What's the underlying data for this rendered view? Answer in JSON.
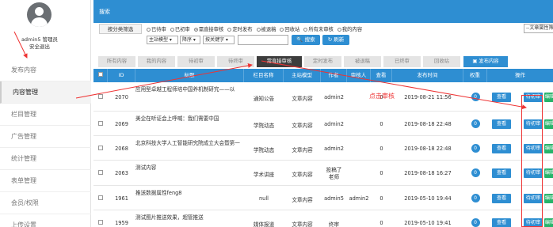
{
  "sidebar": {
    "user": "admin5 管理员",
    "logout": "安全退出",
    "items": [
      {
        "label": "发布内容"
      },
      {
        "label": "内容管理"
      },
      {
        "label": "栏目管理"
      },
      {
        "label": "广告管理"
      },
      {
        "label": "统计管理"
      },
      {
        "label": "表单管理"
      },
      {
        "label": "会员/权限"
      },
      {
        "label": "上传设置"
      }
    ]
  },
  "topbar": {
    "title": "搜索"
  },
  "filter": {
    "category_button": "按分类筛选",
    "radios": [
      {
        "label": "已待审",
        "checked": false
      },
      {
        "label": "已初审",
        "checked": false
      },
      {
        "label": "需直接审核",
        "checked": true
      },
      {
        "label": "定时发布",
        "checked": false
      },
      {
        "label": "被退稿",
        "checked": false
      },
      {
        "label": "回收站",
        "checked": false
      },
      {
        "label": "所有未审核",
        "checked": false
      },
      {
        "label": "我的内容",
        "checked": false
      }
    ],
    "model_select": "主站模型",
    "order_select": "降序",
    "field_select": "按关键字",
    "keyword_placeholder": "",
    "search_button": "搜索",
    "refresh_button": "刷新",
    "sort_select": "--文章属性筛"
  },
  "tabs": [
    {
      "label": "所有内容"
    },
    {
      "label": "我的内容"
    },
    {
      "label": "待初审"
    },
    {
      "label": "待终审"
    },
    {
      "label": "需直接审核"
    },
    {
      "label": "定时发布"
    },
    {
      "label": "被退稿"
    },
    {
      "label": "已终审"
    },
    {
      "label": "回收站"
    },
    {
      "label": "发布内容"
    }
  ],
  "table": {
    "headers": [
      "ID",
      "标题",
      "栏目名称",
      "主站模型",
      "作者",
      "审核人",
      "查看",
      "发布时间",
      "权重",
      "操作"
    ],
    "rows": [
      {
        "id": "2070",
        "title": "应用型卓越工程师培中国养机制研究——以",
        "column": "通知公告",
        "model": "文章内容",
        "author": "admin2",
        "reviewer": "",
        "views": "0",
        "time": "2019-08-21 11:56",
        "weight": "0"
      },
      {
        "id": "2069",
        "title": "美企在听证会上呼喊：我们需要中国",
        "column": "学院动态",
        "model": "文章内容",
        "author": "admin2",
        "reviewer": "",
        "views": "0",
        "time": "2019-08-18 22:48",
        "weight": "0"
      },
      {
        "id": "2068",
        "title": "北京科技大学人工智能研究院成立大会暨第一",
        "column": "学院动态",
        "model": "文章内容",
        "author": "admin2",
        "reviewer": "",
        "views": "0",
        "time": "2019-08-18 22:48",
        "weight": "0"
      },
      {
        "id": "2063",
        "title": "测试内容",
        "column": "学术讲座",
        "model": "文章内容",
        "author": "投稿了\n老师",
        "reviewer": "",
        "views": "0",
        "time": "2019-08-18 16:27",
        "weight": "0"
      },
      {
        "id": "1961",
        "title": "推送数据属性feng8",
        "column": "null",
        "model": "文章内容",
        "author": "admin5",
        "reviewer": "admin2",
        "views": "0",
        "time": "2019-05-10 19:44",
        "weight": "0"
      },
      {
        "id": "1959",
        "title": "测试图片推送效果，超管推送",
        "column": "媒体报道",
        "model": "文章内容",
        "author": "终审",
        "reviewer": "",
        "views": "0",
        "time": "2019-05-10 19:41",
        "weight": "0"
      }
    ],
    "actions": {
      "view": "查看",
      "review": "待初审",
      "edit": "编辑"
    }
  },
  "annotation": {
    "text": "点击审核",
    "color": "#e33333"
  },
  "colors": {
    "accent": "#2e8ed2",
    "active_tab": "#3d3d3d",
    "edit": "#27b36a"
  }
}
